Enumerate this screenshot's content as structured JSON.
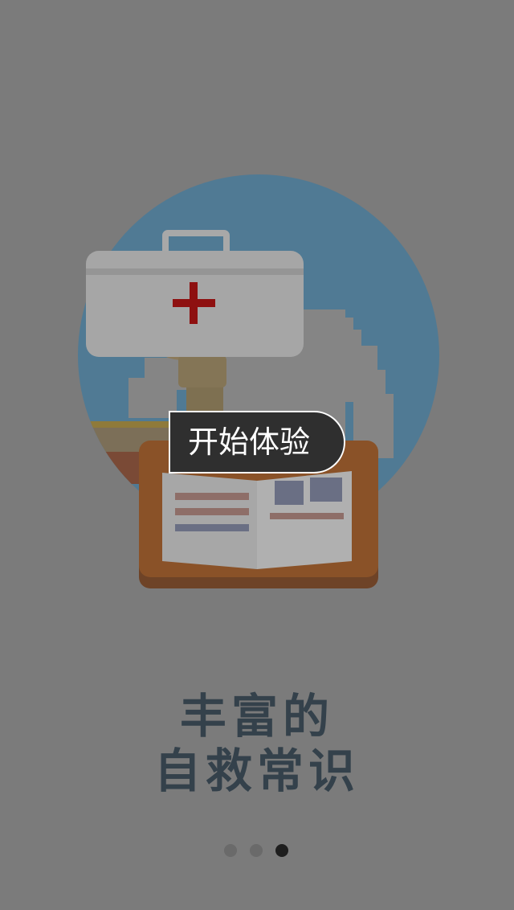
{
  "start_button": {
    "label": "开始体验"
  },
  "headline": {
    "line1": "丰富的",
    "line2": "自救常识"
  },
  "pager": {
    "total": 3,
    "active_index": 2
  },
  "icons": [
    "first-aid-kit-icon",
    "red-cross-icon",
    "hand-icon",
    "open-book-icon",
    "stacked-books-icon"
  ],
  "colors": {
    "overlay": "#7b7b7b",
    "circle": "#507a94",
    "button_bg": "#2f2f2f",
    "headline": "#34414b",
    "dot_active": "#1e1e1e",
    "dot_inactive": "#6a6a6a"
  }
}
